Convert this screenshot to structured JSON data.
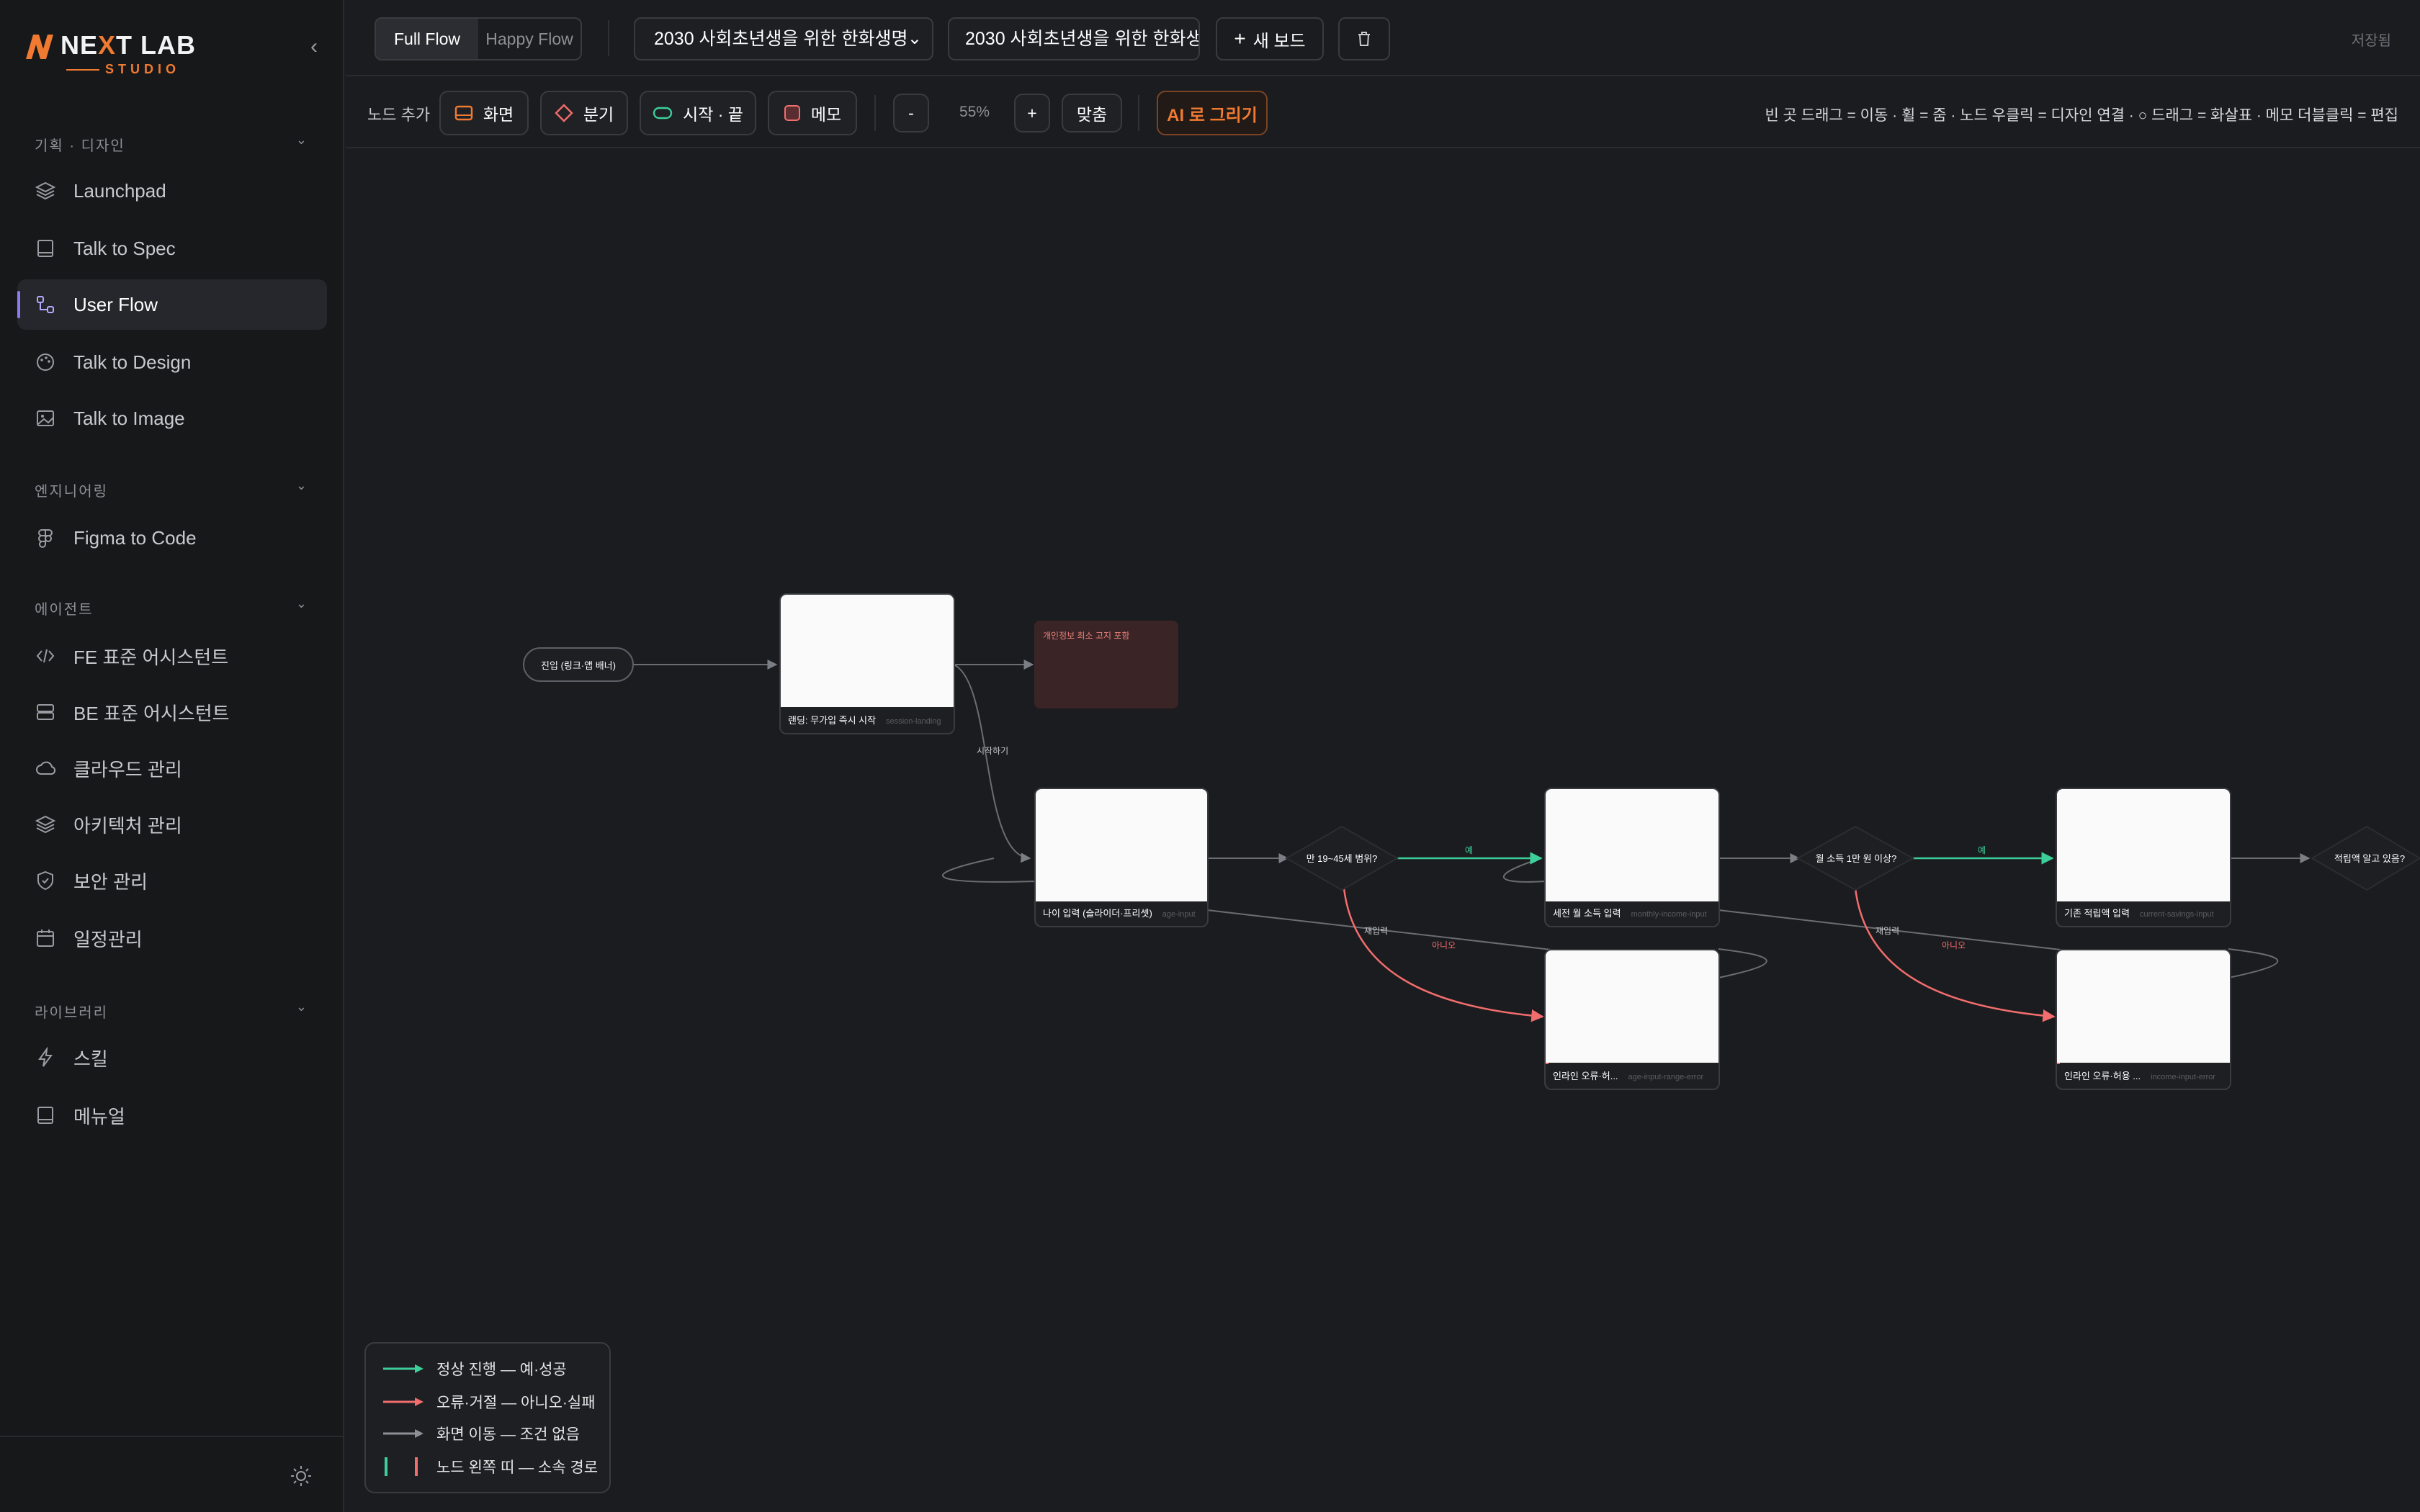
{
  "brand": {
    "name_a": "NE",
    "name_x": "X",
    "name_b": "T LAB",
    "sub": "STUDIO"
  },
  "sidebar": {
    "sections": [
      {
        "label": "기획 · 디자인",
        "items": [
          "Launchpad",
          "Talk to Spec",
          "User Flow",
          "Talk to Design",
          "Talk to Image"
        ]
      },
      {
        "label": "엔지니어링",
        "items": [
          "Figma to Code"
        ]
      },
      {
        "label": "에이전트",
        "items": [
          "FE 표준 어시스턴트",
          "BE 표준 어시스턴트",
          "클라우드 관리",
          "아키텍처 관리",
          "보안 관리",
          "일정관리"
        ]
      },
      {
        "label": "라이브러리",
        "items": [
          "스킬",
          "메뉴얼"
        ]
      }
    ],
    "active": "User Flow"
  },
  "topbar": {
    "flow_tabs": [
      "Full Flow",
      "Happy Flow"
    ],
    "active_tab": "Full Flow",
    "board_select": "2030 사회초년생을 위한 한화생명",
    "board_title": "2030 사회초년생을 위한 한화생'",
    "new_board": "새 보드",
    "saved": "저장됨"
  },
  "toolbar": {
    "add_node_label": "노드 추가",
    "screen": "화면",
    "branch": "분기",
    "start_end": "시작 · 끝",
    "memo": "메모",
    "zoom_out": "-",
    "zoom_level": "55%",
    "zoom_in": "+",
    "fit": "맞춤",
    "ai_draw": "AI 로 그리기",
    "hint": "빈 곳 드래그 = 이동 · 휠 = 줌 · 노드 우클릭 = 디자인 연결 · ○ 드래그 = 화살표 · 메모 더블클릭 = 편집"
  },
  "flow": {
    "start_node": "진입 (링크·앱 배너)",
    "landing": {
      "title": "랜딩: 무가입 즉시 시작",
      "sub": "session-landing"
    },
    "memo": "개인정보 최소 고지 포함",
    "start_edge_label": "시작하기",
    "age": {
      "title": "나이 입력 (슬라이더·프리셋)",
      "sub": "age-input"
    },
    "decision_age": "만 19~45세 범위?",
    "income": {
      "title": "세전 월 소득 입력",
      "sub": "monthly-income-input"
    },
    "decision_income": "월 소득 1만 원 이상?",
    "savings": {
      "title": "기존 적립액 입력",
      "sub": "current-savings-input"
    },
    "decision_savings": "적립액 알고 있음?",
    "age_error": {
      "title": "인라인 오류·허...",
      "sub": "age-input-range-error"
    },
    "income_error": {
      "title": "인라인 오류·허용 ...",
      "sub": "income-input-error"
    },
    "yes": "예",
    "no": "아니오",
    "retry": "재입력"
  },
  "legend": {
    "items": [
      "정상 진행 — 예·성공",
      "오류·거절 — 아니오·실패",
      "화면 이동 — 조건 없음",
      "노드 왼쪽 띠 — 소속 경로"
    ],
    "colors": {
      "success": "#3ccf9a",
      "error": "#f26d6d",
      "neutral": "#8d8f96"
    }
  },
  "icons": {
    "collapse": "chevron-left-icon",
    "new_board": "plus-icon",
    "delete": "trash-icon",
    "theme": "sun-icon"
  }
}
